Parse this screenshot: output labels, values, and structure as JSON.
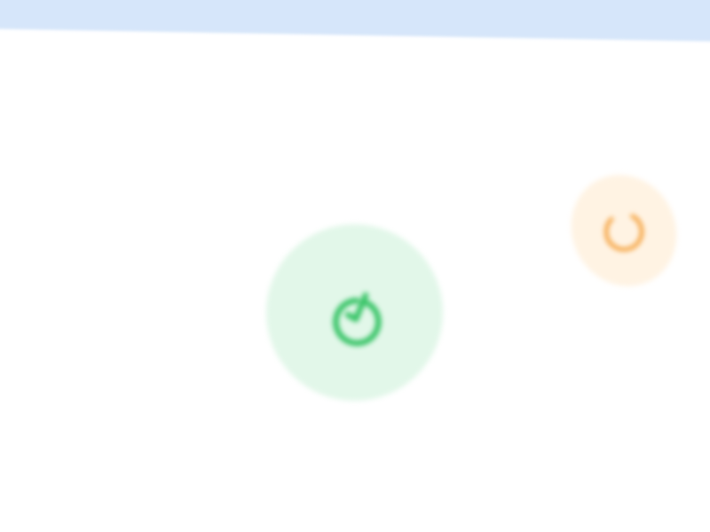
{
  "colors": {
    "header_bar": "#d6e6fa",
    "background": "#ffffff",
    "success_bg": "#e2f7e9",
    "success_fg": "#34c364",
    "pending_bg": "#fff3e3",
    "pending_fg": "#f5a23e"
  },
  "status_indicators": [
    {
      "state": "complete",
      "icon": "clock-check-icon"
    },
    {
      "state": "loading",
      "icon": "loading-spinner-icon"
    }
  ]
}
